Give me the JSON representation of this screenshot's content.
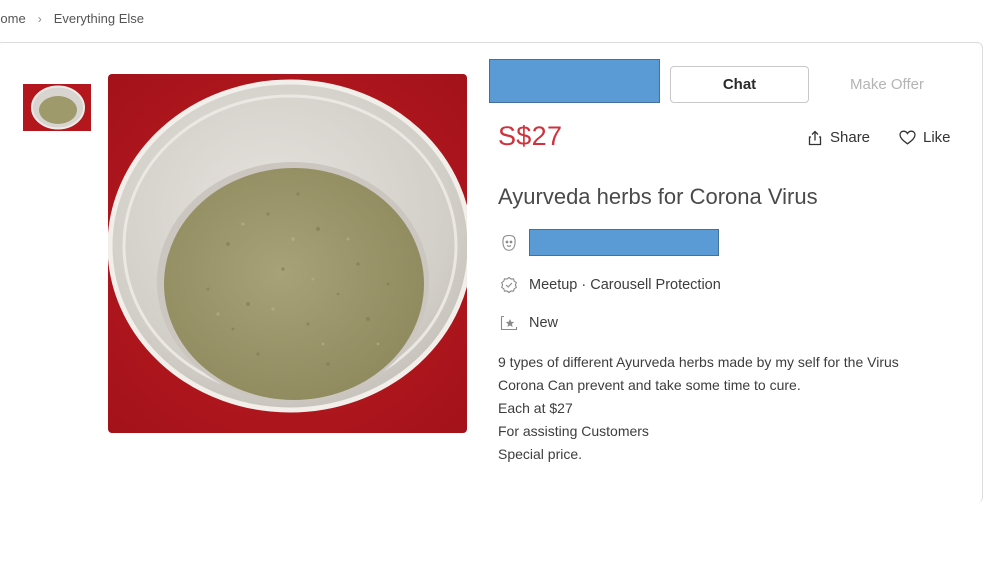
{
  "breadcrumb": {
    "home": "Home",
    "category": "Everything Else"
  },
  "listing": {
    "price": "S$27",
    "title": "Ayurveda herbs for Corona Virus",
    "delivery": "Meetup · Carousell Protection",
    "condition": "New",
    "description": [
      "9 types of different Ayurveda herbs made by my self for the Virus",
      "Corona Can prevent and take some time to cure.",
      "Each at $27",
      "For assisting Customers",
      "Special price."
    ]
  },
  "actions": {
    "chat": "Chat",
    "make_offer": "Make Offer",
    "share": "Share",
    "like": "Like"
  },
  "icons": {
    "breadcrumb_sep": "chevron-right-icon",
    "share": "share-icon",
    "like": "heart-icon",
    "seller": "face-icon",
    "delivery": "shield-badge-icon",
    "condition": "star-tag-icon"
  },
  "colors": {
    "price": "#d0323c",
    "redaction": "#5b9bd5",
    "image_background": "#b3161c",
    "herb_powder": "#9e9a6c"
  }
}
